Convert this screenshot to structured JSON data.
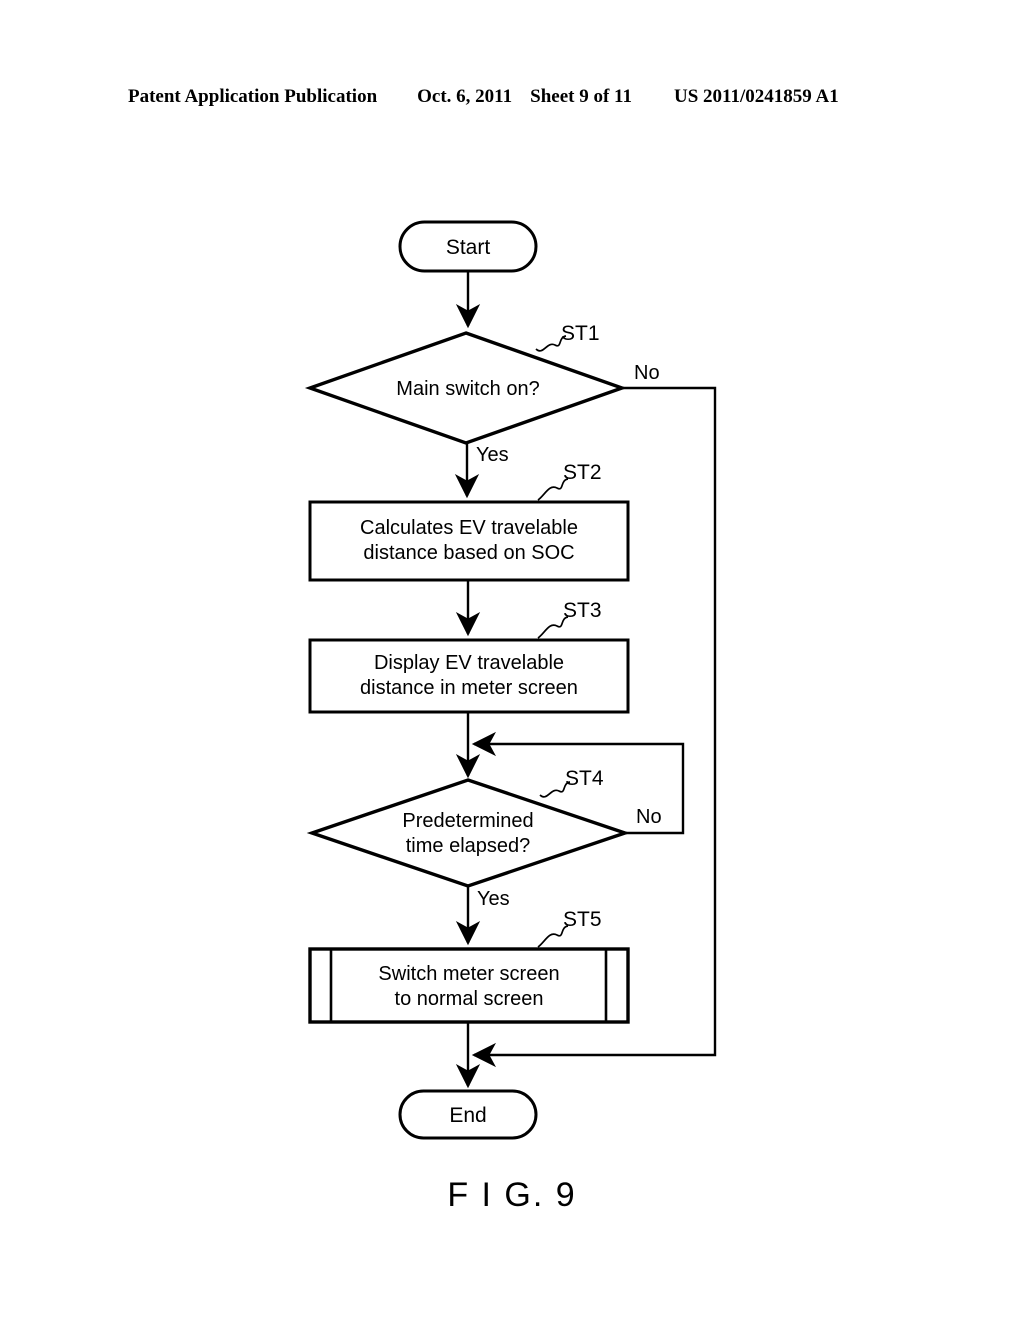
{
  "header": {
    "publication": "Patent Application Publication",
    "date": "Oct. 6, 2011",
    "sheet": "Sheet 9 of 11",
    "patent_number": "US 2011/0241859 A1"
  },
  "figure": {
    "caption": "F I G. 9"
  },
  "flowchart": {
    "start": {
      "label": "Start"
    },
    "end": {
      "label": "End"
    },
    "steps": [
      {
        "tag": "ST1",
        "type": "decision",
        "text": "Main switch on?",
        "yes_label": "Yes",
        "no_label": "No"
      },
      {
        "tag": "ST2",
        "type": "process",
        "text": "Calculates EV travelable\ndistance based on SOC"
      },
      {
        "tag": "ST3",
        "type": "process",
        "text": "Display EV travelable\ndistance in meter screen"
      },
      {
        "tag": "ST4",
        "type": "decision",
        "text": "Predetermined\ntime elapsed?",
        "yes_label": "Yes",
        "no_label": "No"
      },
      {
        "tag": "ST5",
        "type": "predefined-process",
        "text": "Switch meter screen\nto normal screen"
      }
    ]
  },
  "colors": {
    "ink": "#000000",
    "paper": "#ffffff"
  }
}
